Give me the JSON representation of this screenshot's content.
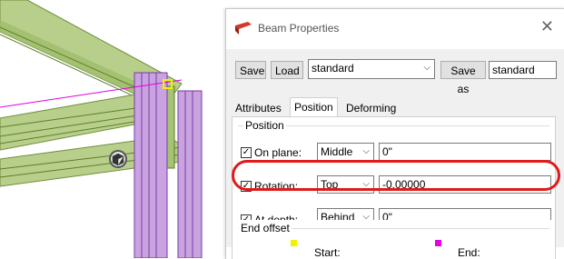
{
  "dialog": {
    "title": "Beam Properties",
    "close_icon": "close-icon",
    "toolbar": {
      "save_label": "Save",
      "load_label": "Load",
      "preset_value": "standard",
      "save_as_label": "Save as",
      "save_as_value": "standard"
    },
    "tabs": [
      {
        "label": "Attributes"
      },
      {
        "label": "Position"
      },
      {
        "label": "Deforming"
      }
    ],
    "position_group": {
      "label": "Position",
      "on_plane": {
        "label": "On plane:",
        "checked": true,
        "option": "Middle",
        "value": "0\""
      },
      "rotation": {
        "label": "Rotation:",
        "checked": true,
        "option": "Top",
        "value": "-0.00000"
      },
      "at_depth": {
        "label": "At depth:",
        "checked": true,
        "option": "Behind",
        "value": "0\""
      }
    },
    "end_offset_group": {
      "label": "End offset",
      "start_label": "Start:",
      "end_label": "End:",
      "start_color": "#f2f200",
      "end_color": "#e600e6"
    }
  },
  "viewport": {
    "beam_color": "#b7cf8a",
    "column_color": "#b98bd6",
    "axis_color": "#e000e0",
    "handle_icon": "rotate-handle-icon"
  },
  "highlight_color": "#e01a1a"
}
